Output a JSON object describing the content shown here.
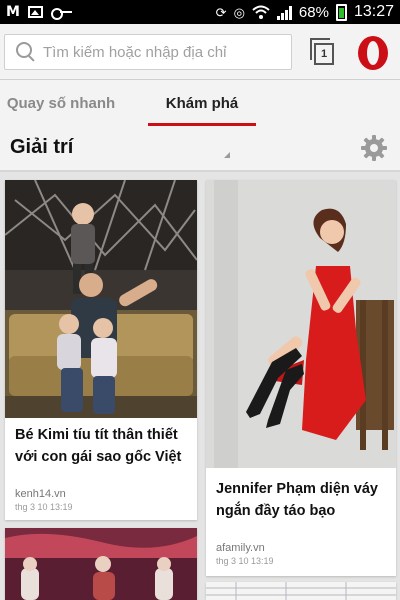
{
  "status_bar": {
    "battery": "68%",
    "time": "13:27",
    "icons": [
      "gmail-m-icon",
      "image-icon",
      "key-icon",
      "rotate-icon",
      "circle-icon",
      "wifi-icon",
      "signal-icon",
      "battery-icon"
    ]
  },
  "address_bar": {
    "placeholder": "Tìm kiếm hoặc nhập địa chỉ",
    "tab_count": "1"
  },
  "tabs": [
    {
      "label": "Quay số nhanh",
      "active": false
    },
    {
      "label": "Khám phá",
      "active": true
    }
  ],
  "category": {
    "title": "Giải trí"
  },
  "articles": [
    {
      "title_line1": "Bé Kimi tíu tít thân thiết",
      "title_line2": "với con gái sao gốc Việt",
      "source": "kenh14.vn",
      "time": "thg 3 10 13:19"
    },
    {
      "title_line1": "Jennifer Phạm diện váy",
      "title_line2": "ngắn đầy táo bạo",
      "source": "afamily.vn",
      "time": "thg 3 10 13:19"
    }
  ],
  "colors": {
    "accent": "#cc0f16",
    "background": "#e4e4e4",
    "bar": "#f3f3f3"
  }
}
